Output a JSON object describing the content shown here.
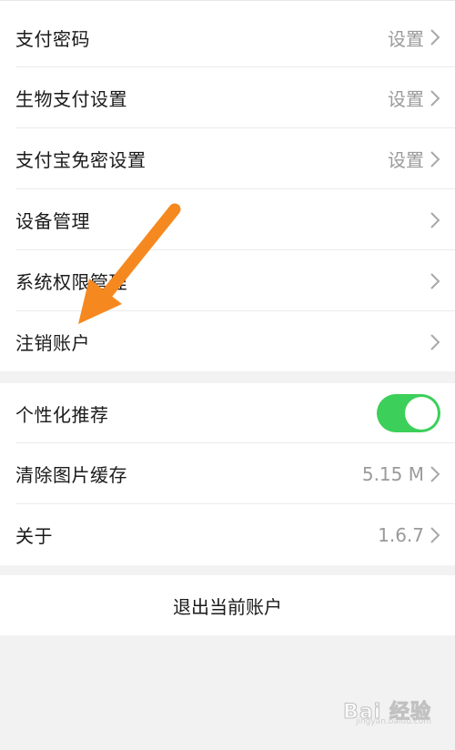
{
  "settings_group_1": [
    {
      "label": "支付密码",
      "value": "设置"
    },
    {
      "label": "生物支付设置",
      "value": "设置"
    },
    {
      "label": "支付宝免密设置",
      "value": "设置"
    },
    {
      "label": "设备管理",
      "value": ""
    },
    {
      "label": "系统权限管理",
      "value": ""
    },
    {
      "label": "注销账户",
      "value": ""
    }
  ],
  "settings_group_2": [
    {
      "label": "个性化推荐",
      "toggle": true
    },
    {
      "label": "清除图片缓存",
      "value": "5.15 M"
    },
    {
      "label": "关于",
      "value": "1.6.7"
    }
  ],
  "logout": {
    "label": "退出当前账户"
  },
  "watermark": {
    "text": "Bai 经验",
    "sub": "jingyan.baidu.com"
  },
  "colors": {
    "toggle_on": "#3ccf5a",
    "arrow": "#f5891f"
  }
}
